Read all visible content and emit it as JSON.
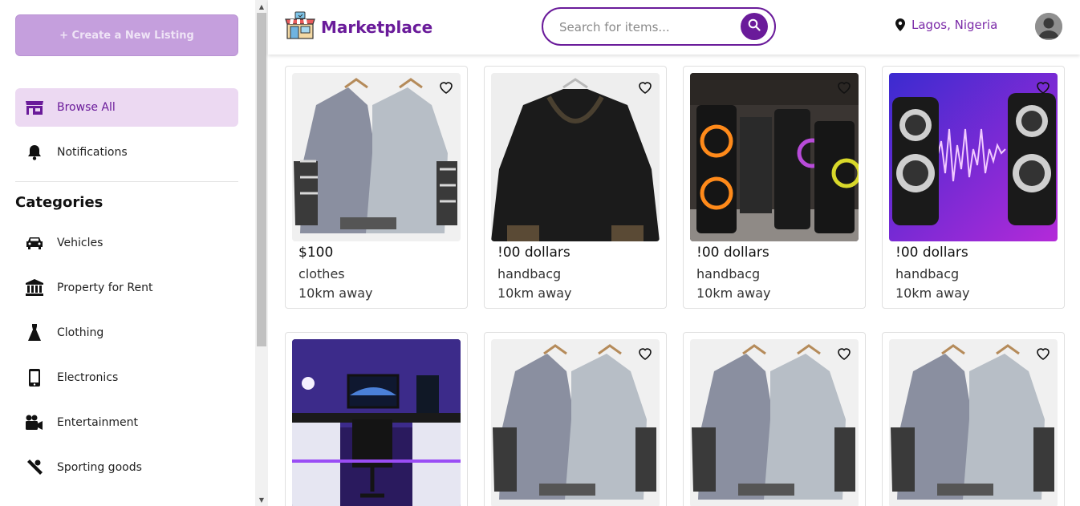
{
  "sidebar": {
    "create_label": "+ Create a New Listing",
    "nav": [
      {
        "label": "Browse All",
        "icon": "store-icon"
      },
      {
        "label": "Notifications",
        "icon": "bell-icon"
      }
    ],
    "categories_heading": "Categories",
    "categories": [
      {
        "label": "Vehicles",
        "icon": "car-icon"
      },
      {
        "label": "Property for Rent",
        "icon": "building-icon"
      },
      {
        "label": "Clothing",
        "icon": "dress-icon"
      },
      {
        "label": "Electronics",
        "icon": "phone-icon"
      },
      {
        "label": "Entertainment",
        "icon": "video-camera-icon"
      },
      {
        "label": "Sporting goods",
        "icon": "sports-icon"
      }
    ]
  },
  "header": {
    "logo_text": "Marketplace",
    "search_placeholder": "Search for items...",
    "location": "Lagos, Nigeria"
  },
  "colors": {
    "brand": "#6a1b9a",
    "active_bg": "#ecd9f2",
    "create_bg": "#c59fdd"
  },
  "listings": [
    {
      "price": "$100",
      "category": "clothes",
      "distance": "10km away",
      "image": "hoodie"
    },
    {
      "price": "!00 dollars",
      "category": "handbacg",
      "distance": "10km away",
      "image": "black-hoodie"
    },
    {
      "price": "!00 dollars",
      "category": "handbacg",
      "distance": "10km away",
      "image": "party-speakers"
    },
    {
      "price": "!00 dollars",
      "category": "handbacg",
      "distance": "10km away",
      "image": "desk-speakers"
    },
    {
      "image": "gaming-desk"
    },
    {
      "image": "hoodie"
    },
    {
      "image": "hoodie"
    },
    {
      "image": "hoodie"
    }
  ]
}
